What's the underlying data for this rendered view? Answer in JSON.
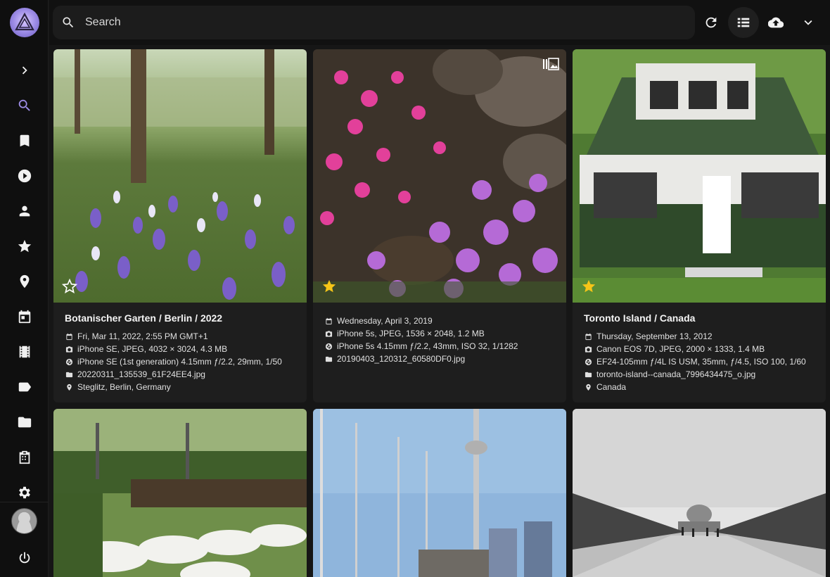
{
  "search": {
    "placeholder": "Search",
    "value": ""
  },
  "colors": {
    "accent": "#9d8ce6",
    "star": "#f5c518",
    "background": "#161616",
    "card": "#1e1e1e"
  },
  "sidebar": {
    "items": [
      {
        "icon": "chevron-right-icon"
      },
      {
        "icon": "search-icon",
        "active": true
      },
      {
        "icon": "bookmark-icon"
      },
      {
        "icon": "play-icon"
      },
      {
        "icon": "person-icon"
      },
      {
        "icon": "star-icon"
      },
      {
        "icon": "location-pin-icon"
      },
      {
        "icon": "calendar-icon"
      },
      {
        "icon": "film-icon"
      },
      {
        "icon": "label-icon"
      },
      {
        "icon": "folder-icon"
      },
      {
        "icon": "library-icon"
      },
      {
        "icon": "settings-icon"
      },
      {
        "icon": "power-icon"
      }
    ]
  },
  "toolbar": {
    "icons": [
      "refresh-icon",
      "list-view-icon",
      "upload-icon",
      "chevron-down-icon"
    ]
  },
  "cards": [
    {
      "title": "Botanischer Garten / Berlin / 2022",
      "date": "Fri, Mar 11, 2022, 2:55 PM GMT+1",
      "camera": "iPhone SE, JPEG, 4032 × 3024, 4.3 MB",
      "lens": "iPhone SE (1st generation) 4.15mm ƒ/2.2, 29mm, 1/50",
      "file": "20220311_135539_61F24EE4.jpg",
      "location": "Steglitz, Berlin, Germany",
      "favorite": false
    },
    {
      "title": "",
      "date": "Wednesday, April 3, 2019",
      "camera": "iPhone 5s, JPEG, 1536 × 2048, 1.2 MB",
      "lens": "iPhone 5s 4.15mm ƒ/2.2, 43mm, ISO 32, 1/1282",
      "file": "20190403_120312_60580DF0.jpg",
      "favorite": true
    },
    {
      "title": "Toronto Island / Canada",
      "date": "Thursday, September 13, 2012",
      "camera": "Canon EOS 7D, JPEG, 2000 × 1333, 1.4 MB",
      "lens": "EF24-105mm ƒ/4L IS USM, 35mm, ƒ/4.5, ISO 100, 1/60",
      "file": "toronto-island--canada_7996434475_o.jpg",
      "location": "Canada",
      "favorite": true
    }
  ]
}
